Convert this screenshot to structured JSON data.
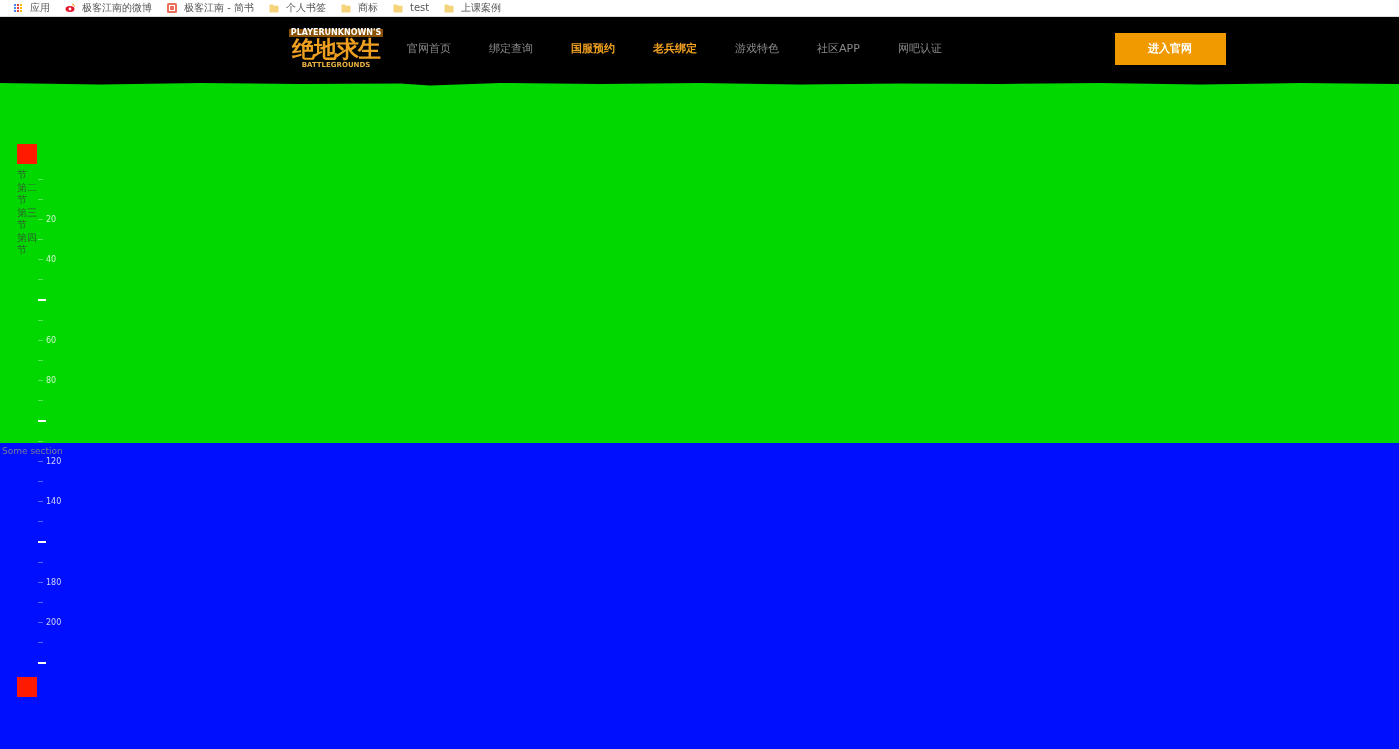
{
  "bookmarks_bar": {
    "items": [
      {
        "kind": "apps",
        "label": "应用"
      },
      {
        "kind": "weibo",
        "label": "极客江南的微博"
      },
      {
        "kind": "jianshu",
        "label": "极客江南 - 简书"
      },
      {
        "kind": "folder",
        "label": "个人书签"
      },
      {
        "kind": "folder",
        "label": "商标"
      },
      {
        "kind": "folder",
        "label": "test"
      },
      {
        "kind": "folder",
        "label": "上课案例"
      }
    ]
  },
  "header": {
    "logo": {
      "top": "PLAYERUNKNOWN'S",
      "title": "绝地求生",
      "bottom": "BATTLEGROUNDS"
    },
    "nav": [
      {
        "label": "官网首页",
        "highlighted": false
      },
      {
        "label": "绑定查询",
        "highlighted": false
      },
      {
        "label": "国服预约",
        "highlighted": true
      },
      {
        "label": "老兵绑定",
        "highlighted": true
      },
      {
        "label": "游戏特色",
        "highlighted": false
      },
      {
        "label": "社区APP",
        "highlighted": false
      },
      {
        "label": "网吧认证",
        "highlighted": false
      }
    ],
    "cta_button": "进入官网"
  },
  "side_overlay": {
    "chapters": [
      "节",
      "第二节",
      "第三节",
      "第四节"
    ],
    "ruler": [
      {
        "kind": "minor"
      },
      {
        "kind": "minor"
      },
      {
        "kind": "label",
        "label": "20"
      },
      {
        "kind": "minor"
      },
      {
        "kind": "label",
        "label": "40"
      },
      {
        "kind": "minor"
      },
      {
        "kind": "major"
      },
      {
        "kind": "minor"
      },
      {
        "kind": "label",
        "label": "60"
      },
      {
        "kind": "minor"
      },
      {
        "kind": "label",
        "label": "80"
      },
      {
        "kind": "minor"
      },
      {
        "kind": "major"
      },
      {
        "kind": "minor"
      },
      {
        "kind": "label",
        "label": "120"
      },
      {
        "kind": "minor"
      },
      {
        "kind": "label",
        "label": "140"
      },
      {
        "kind": "minor"
      },
      {
        "kind": "major"
      },
      {
        "kind": "minor"
      },
      {
        "kind": "label",
        "label": "180"
      },
      {
        "kind": "minor"
      },
      {
        "kind": "label",
        "label": "200"
      },
      {
        "kind": "minor"
      },
      {
        "kind": "major"
      }
    ]
  },
  "sections": [
    {
      "kind": "green"
    },
    {
      "kind": "blue",
      "label": "Some section"
    }
  ]
}
